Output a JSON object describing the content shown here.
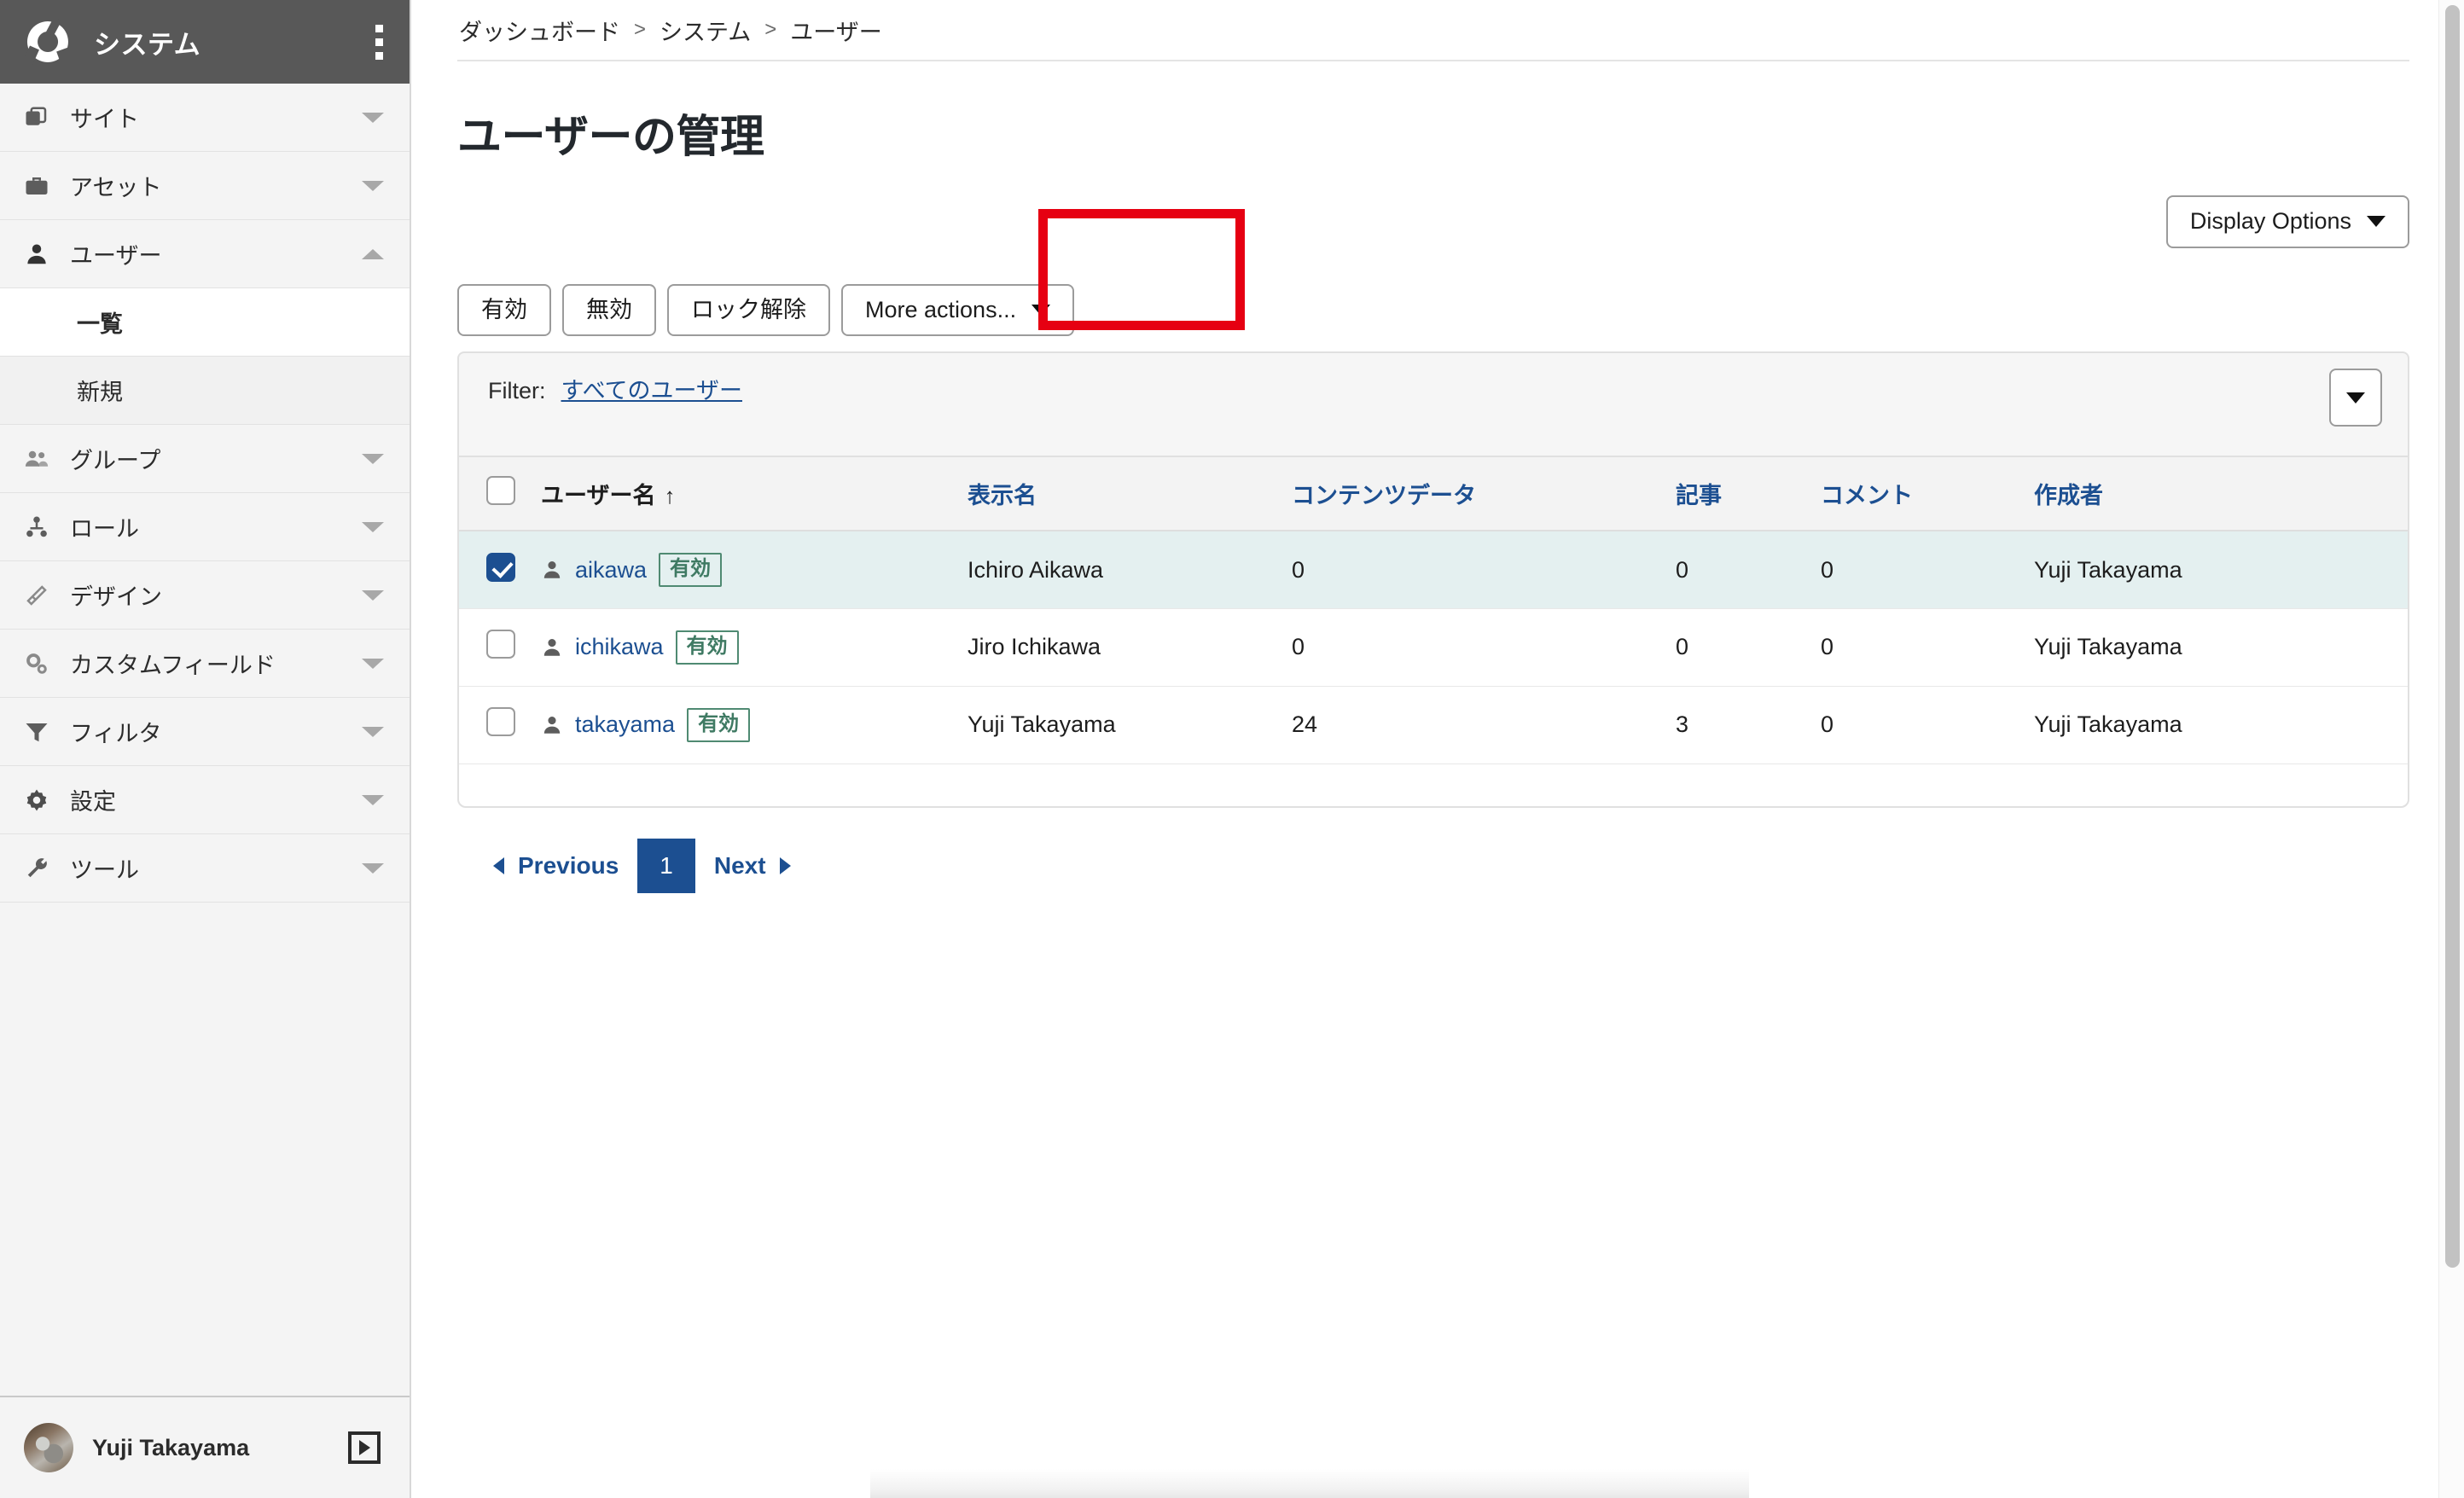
{
  "sidebar": {
    "brand": {
      "title": "システム",
      "logo_icon": "ring-logo-icon",
      "menu_icon": "kebab-menu-icon"
    },
    "items": [
      {
        "label": "サイト",
        "icon": "copy-windows-icon",
        "state": "collapsed"
      },
      {
        "label": "アセット",
        "icon": "briefcase-icon",
        "state": "collapsed"
      },
      {
        "label": "ユーザー",
        "icon": "person-icon",
        "state": "expanded"
      },
      {
        "label": "グループ",
        "icon": "people-icon",
        "state": "collapsed"
      },
      {
        "label": "ロール",
        "icon": "hierarchy-icon",
        "state": "collapsed"
      },
      {
        "label": "デザイン",
        "icon": "paintbrush-icon",
        "state": "collapsed"
      },
      {
        "label": "カスタムフィールド",
        "icon": "gears-icon",
        "state": "collapsed"
      },
      {
        "label": "フィルタ",
        "icon": "funnel-icon",
        "state": "collapsed"
      },
      {
        "label": "設定",
        "icon": "gear-icon",
        "state": "collapsed"
      },
      {
        "label": "ツール",
        "icon": "wrench-icon",
        "state": "collapsed"
      }
    ],
    "sub_items": [
      {
        "label": "一覧",
        "active": true
      },
      {
        "label": "新規",
        "active": false
      }
    ],
    "footer": {
      "user_name": "Yuji Takayama",
      "expand_icon": "expand-panel-icon",
      "avatar": "user-avatar"
    }
  },
  "breadcrumb": {
    "items": [
      "ダッシュボード",
      "システム",
      "ユーザー"
    ],
    "separator": ">"
  },
  "page": {
    "title": "ユーザーの管理"
  },
  "display_options": {
    "label": "Display Options",
    "caret_icon": "chevron-down-icon"
  },
  "toolbar": {
    "enable_label": "有効",
    "disable_label": "無効",
    "unlock_label": "ロック解除",
    "more_actions_label": "More actions...",
    "more_actions_caret_icon": "chevron-down-icon",
    "highlight_color": "#e60012",
    "highlighted_button": "ロック解除"
  },
  "filter": {
    "label": "Filter:",
    "value": "すべてのユーザー",
    "dropdown_icon": "chevron-down-icon"
  },
  "table": {
    "columns": [
      {
        "key": "check",
        "label": "",
        "type": "checkbox"
      },
      {
        "key": "username",
        "label": "ユーザー名",
        "sorted": true,
        "sort_dir": "↑"
      },
      {
        "key": "display_name",
        "label": "表示名"
      },
      {
        "key": "content_data",
        "label": "コンテンツデータ"
      },
      {
        "key": "articles",
        "label": "記事"
      },
      {
        "key": "comments",
        "label": "コメント"
      },
      {
        "key": "author",
        "label": "作成者"
      }
    ],
    "header_checkbox_checked": false,
    "rows": [
      {
        "checked": true,
        "selected": true,
        "username": "aikawa",
        "status_badge": "有効",
        "display_name": "Ichiro Aikawa",
        "content_data": "0",
        "articles": "0",
        "comments": "0",
        "author": "Yuji Takayama"
      },
      {
        "checked": false,
        "selected": false,
        "username": "ichikawa",
        "status_badge": "有効",
        "display_name": "Jiro Ichikawa",
        "content_data": "0",
        "articles": "0",
        "comments": "0",
        "author": "Yuji Takayama"
      },
      {
        "checked": false,
        "selected": false,
        "username": "takayama",
        "status_badge": "有効",
        "display_name": "Yuji Takayama",
        "content_data": "24",
        "articles": "3",
        "comments": "0",
        "author": "Yuji Takayama"
      }
    ]
  },
  "pagination": {
    "previous_label": "Previous",
    "next_label": "Next",
    "current_page": "1",
    "prev_icon": "triangle-left-icon",
    "next_icon": "triangle-right-icon"
  },
  "colors": {
    "sidebar_header": "#585858",
    "sidebar_bg": "#f4f4f4",
    "link_blue": "#1c4f91",
    "badge_green": "#3f7a63",
    "selected_row": "#e4f0f0",
    "highlight_red": "#e60012"
  }
}
